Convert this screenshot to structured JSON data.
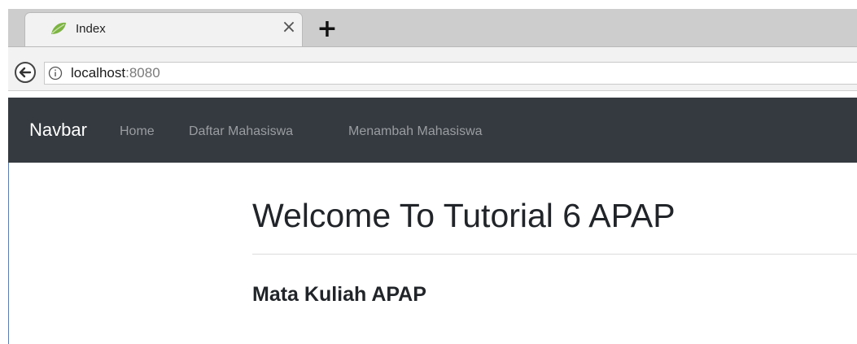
{
  "browser": {
    "tab": {
      "title": "Index",
      "favicon": "spring-leaf-icon",
      "close_glyph": "×"
    },
    "new_tab_glyph": "+",
    "address": {
      "host": "localhost",
      "port": ":8080"
    }
  },
  "navbar": {
    "brand": "Navbar",
    "links": [
      {
        "label": "Home"
      },
      {
        "label": "Daftar Mahasiswa"
      },
      {
        "label": "Menambah Mahasiswa"
      }
    ],
    "bg_color": "#343a40"
  },
  "main": {
    "title": "Welcome To Tutorial 6 APAP",
    "subtitle": "Mata Kuliah APAP"
  }
}
